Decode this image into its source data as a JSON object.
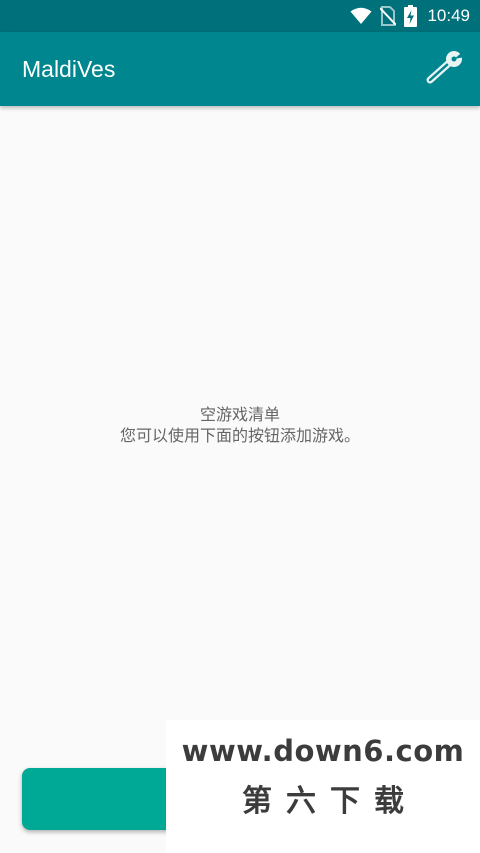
{
  "status_bar": {
    "time": "10:49",
    "icons": [
      "wifi-icon",
      "no-sim-icon",
      "battery-charging-icon"
    ]
  },
  "app_bar": {
    "title": "MaldiVes",
    "settings_icon": "wrench-icon"
  },
  "empty_state": {
    "title": "空游戏清单",
    "message": "您可以使用下面的按钮添加游戏。"
  },
  "watermark": {
    "url": "www.down6.com",
    "name": "第六下载"
  },
  "colors": {
    "status_bar": "#00707a",
    "app_bar": "#00868f",
    "add_button": "#00a896",
    "background": "#fafafa",
    "text_secondary": "#666666"
  }
}
